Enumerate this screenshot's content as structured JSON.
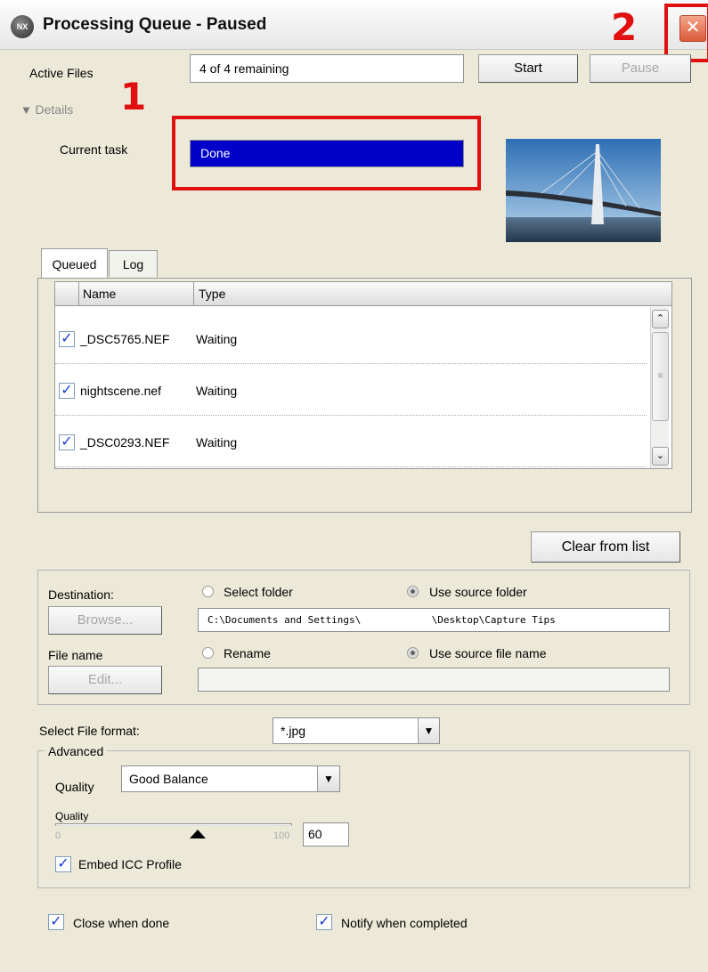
{
  "window": {
    "title": "Processing Queue - Paused",
    "app_icon_text": "NX",
    "close_glyph": "✕"
  },
  "markers": {
    "one": "1",
    "two": "2"
  },
  "header": {
    "active_files_label": "Active Files",
    "active_files_value": "4 of 4 remaining",
    "start_label": "Start",
    "pause_label": "Pause"
  },
  "details": {
    "toggle_label": "Details",
    "current_task_label": "Current task",
    "current_task_value": "Done",
    "progress": 1.0,
    "progress_color": "#0000c8"
  },
  "tabs": [
    {
      "label": "Queued",
      "active": true
    },
    {
      "label": "Log",
      "active": false
    }
  ],
  "queue_table": {
    "columns": [
      "Name",
      "Type"
    ],
    "rows": [
      {
        "checked": true,
        "name": "_DSC5765.NEF",
        "type": "Waiting"
      },
      {
        "checked": true,
        "name": "nightscene.nef",
        "type": "Waiting"
      },
      {
        "checked": true,
        "name": "_DSC0293.NEF",
        "type": "Waiting"
      }
    ]
  },
  "clear_label": "Clear from list",
  "destination": {
    "label": "Destination:",
    "browse_label": "Browse...",
    "select_folder_label": "Select folder",
    "use_source_folder_label": "Use source folder",
    "folder_selected": "source",
    "path_value": "C:\\Documents and Settings\\            \\Desktop\\Capture Tips",
    "file_name_label": "File name",
    "edit_label": "Edit...",
    "rename_label": "Rename",
    "use_source_name_label": "Use source file name",
    "name_selected": "source",
    "rename_value": ""
  },
  "format": {
    "label": "Select File format:",
    "value": "*.jpg"
  },
  "advanced": {
    "legend": "Advanced",
    "quality_label": "Quality",
    "quality_preset": "Good Balance",
    "slider_label": "Quality",
    "slider_min": "0",
    "slider_max": "100",
    "slider_value": 60,
    "quality_value": "60",
    "embed_icc_label": "Embed ICC Profile",
    "embed_icc_checked": true
  },
  "footer": {
    "close_when_done_label": "Close when done",
    "close_when_done_checked": true,
    "notify_label": "Notify when completed",
    "notify_checked": true
  },
  "colors": {
    "marker_red": "#e01010",
    "task_bar_blue": "#0000c8",
    "check_blue": "#1a3cd0"
  }
}
